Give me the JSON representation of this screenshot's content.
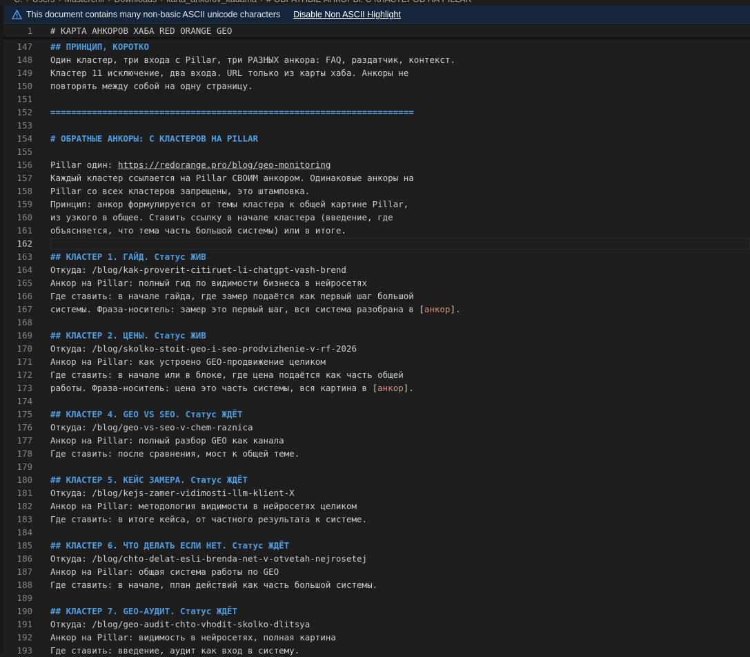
{
  "breadcrumb": [
    "C:",
    "Users",
    "Masterchif",
    "Downloads",
    "karta_ankorov_kadama",
    "# ОБРАТНЫЕ АНКОРЫ: С КЛАСТЕРОВ НА PILLAR"
  ],
  "banner": {
    "icon": "warning-icon",
    "message": "This document contains many non-basic ASCII unicode characters",
    "action": "Disable Non ASCII Highlight"
  },
  "colors": {
    "heading": "#4d9de0",
    "text": "#cccccc",
    "anchor": "#ce9178",
    "line_number": "#858585",
    "banner_bg": "#15253a"
  },
  "sticky_line": {
    "num": "1",
    "text": "# КАРТА АНКОРОВ ХАБА RED ORANGE GEO"
  },
  "active_line": "162",
  "lines": [
    {
      "num": "147",
      "heading": "## ПРИНЦИП, КОРОТКО"
    },
    {
      "num": "148",
      "text": "Один кластер, три входа с Pillar, три РАЗНЫХ анкора: FAQ, раздатчик, контекст."
    },
    {
      "num": "149",
      "text": "Кластер 11 исключение, два входа. URL только из карты хаба. Анкоры не"
    },
    {
      "num": "150",
      "text": "повторять между собой на одну страницу."
    },
    {
      "num": "151"
    },
    {
      "num": "152",
      "heading": "======================================================================"
    },
    {
      "num": "153"
    },
    {
      "num": "154",
      "heading": "# ОБРАТНЫЕ АНКОРЫ: С КЛАСТЕРОВ НА PILLAR"
    },
    {
      "num": "155"
    },
    {
      "num": "156",
      "text": "Pillar один: ",
      "url": "https://redorange.pro/blog/geo-monitoring"
    },
    {
      "num": "157",
      "text": "Каждый кластер ссылается на Pillar СВОИМ анкором. Одинаковые анкоры на"
    },
    {
      "num": "158",
      "text": "Pillar со всех кластеров запрещены, это штамповка."
    },
    {
      "num": "159",
      "text": "Принцип: анкор формулируется от темы кластера к общей картине Pillar,"
    },
    {
      "num": "160",
      "text": "из узкого в общее. Ставить ссылку в начале кластера (введение, где"
    },
    {
      "num": "161",
      "text": "объясняется, что тема часть большой системы) или в итоге."
    },
    {
      "num": "162"
    },
    {
      "num": "163",
      "heading": "## КЛАСТЕР 1. ГАЙД. Статус ЖИВ"
    },
    {
      "num": "164",
      "text": "Откуда: /blog/kak-proverit-citiruet-li-chatgpt-vash-brend"
    },
    {
      "num": "165",
      "text": "Анкор на Pillar: полный гид по видимости бизнеса в нейросетях"
    },
    {
      "num": "166",
      "text": "Где ставить: в начале гайда, где замер подаётся как первый шаг большой"
    },
    {
      "num": "167",
      "text": "системы. Фраза-носитель: замер это первый шаг, вся система разобрана в ",
      "anchor": "анкор",
      "after": "."
    },
    {
      "num": "168"
    },
    {
      "num": "169",
      "heading": "## КЛАСТЕР 2. ЦЕНЫ. Статус ЖИВ"
    },
    {
      "num": "170",
      "text": "Откуда: /blog/skolko-stoit-geo-i-seo-prodvizhenie-v-rf-2026"
    },
    {
      "num": "171",
      "text": "Анкор на Pillar: как устроено GEO-продвижение целиком"
    },
    {
      "num": "172",
      "text": "Где ставить: в начале или в блоке, где цена подаётся как часть общей"
    },
    {
      "num": "173",
      "text": "работы. Фраза-носитель: цена это часть системы, вся картина в ",
      "anchor": "анкор",
      "after": "."
    },
    {
      "num": "174"
    },
    {
      "num": "175",
      "heading": "## КЛАСТЕР 4. GEO VS SEO. Статус ЖДЁТ"
    },
    {
      "num": "176",
      "text": "Откуда: /blog/geo-vs-seo-v-chem-raznica"
    },
    {
      "num": "177",
      "text": "Анкор на Pillar: полный разбор GEO как канала"
    },
    {
      "num": "178",
      "text": "Где ставить: после сравнения, мост к общей теме."
    },
    {
      "num": "179"
    },
    {
      "num": "180",
      "heading": "## КЛАСТЕР 5. КЕЙС ЗАМЕРА. Статус ЖДЁТ"
    },
    {
      "num": "181",
      "text": "Откуда: /blog/kejs-zamer-vidimosti-llm-klient-X"
    },
    {
      "num": "182",
      "text": "Анкор на Pillar: методология видимости в нейросетях целиком"
    },
    {
      "num": "183",
      "text": "Где ставить: в итоге кейса, от частного результата к системе."
    },
    {
      "num": "184"
    },
    {
      "num": "185",
      "heading": "## КЛАСТЕР 6. ЧТО ДЕЛАТЬ ЕСЛИ НЕТ. Статус ЖДЁТ"
    },
    {
      "num": "186",
      "text": "Откуда: /blog/chto-delat-esli-brenda-net-v-otvetah-nejrosetej"
    },
    {
      "num": "187",
      "text": "Анкор на Pillar: общая система работы по GEO"
    },
    {
      "num": "188",
      "text": "Где ставить: в начале, план действий как часть большой системы."
    },
    {
      "num": "189"
    },
    {
      "num": "190",
      "heading": "## КЛАСТЕР 7. GEO-АУДИТ. Статус ЖДЁТ"
    },
    {
      "num": "191",
      "text": "Откуда: /blog/geo-audit-chto-vhodit-skolko-dlitsya"
    },
    {
      "num": "192",
      "text": "Анкор на Pillar: видимость в нейросетях, полная картина"
    },
    {
      "num": "193",
      "text": "Где ставить: введение, аудит как вход в систему."
    }
  ]
}
